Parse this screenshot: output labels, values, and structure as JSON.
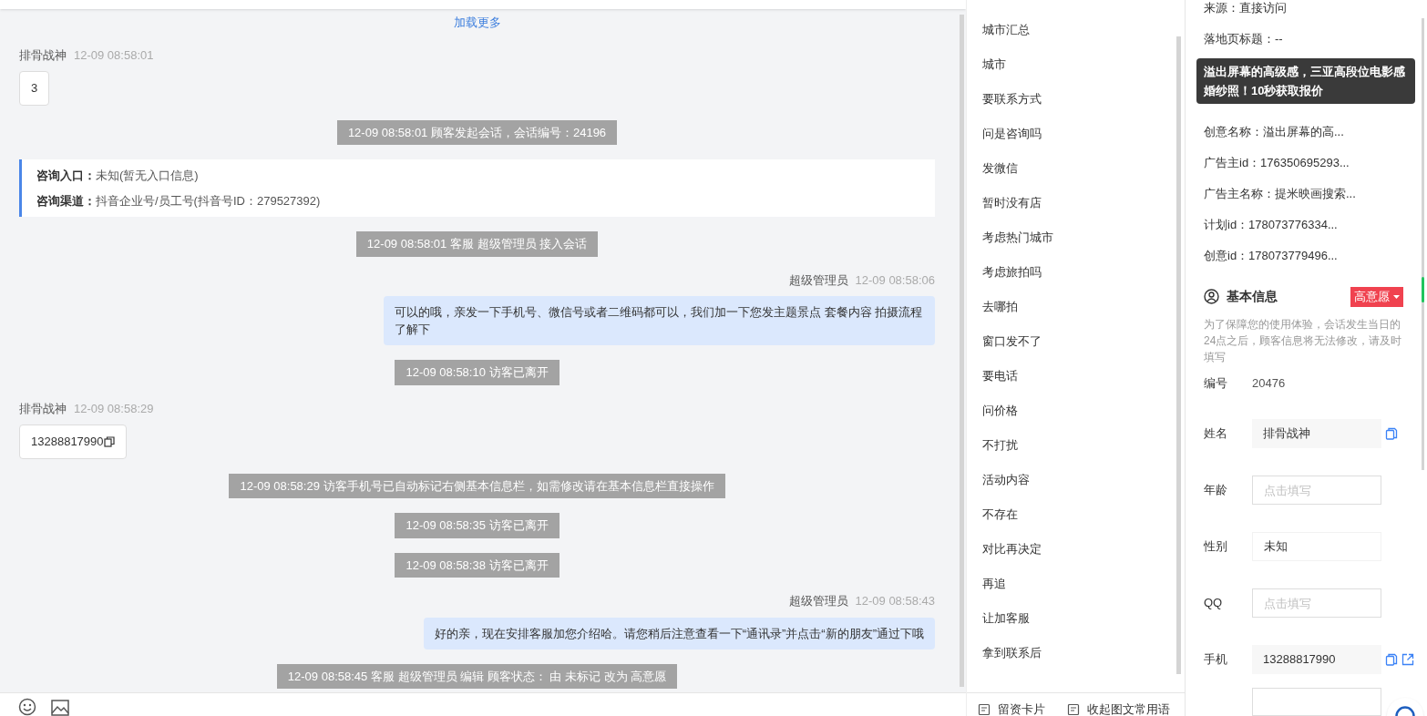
{
  "chat": {
    "load_more": "加载更多",
    "messages": [
      {
        "kind": "visitor",
        "name": "排骨战神",
        "time": "12-09 08:58:01",
        "text": "3"
      },
      {
        "kind": "system",
        "text": "12-09 08:58:01 顾客发起会话，会话编号：24196"
      },
      {
        "kind": "entry",
        "lines": [
          {
            "label": "咨询入口：",
            "value": "未知(暂无入口信息)"
          },
          {
            "label": "咨询渠道：",
            "value": "抖音企业号/员工号(抖音号ID：279527392)"
          }
        ]
      },
      {
        "kind": "system",
        "text": "12-09 08:58:01 客服 超级管理员 接入会话"
      },
      {
        "kind": "agent",
        "name": "超级管理员",
        "time": "12-09 08:58:06",
        "text": "可以的哦，亲发一下手机号、微信号或者二维码都可以，我们加一下您发主题景点 套餐内容 拍摄流程了解下"
      },
      {
        "kind": "system",
        "text": "12-09 08:58:10 访客已离开"
      },
      {
        "kind": "visitor",
        "name": "排骨战神",
        "time": "12-09 08:58:29",
        "text": "13288817990",
        "copyable": true
      },
      {
        "kind": "system",
        "text": "12-09 08:58:29 访客手机号已自动标记右侧基本信息栏，如需修改请在基本信息栏直接操作"
      },
      {
        "kind": "system",
        "text": "12-09 08:58:35 访客已离开"
      },
      {
        "kind": "system",
        "text": "12-09 08:58:38 访客已离开"
      },
      {
        "kind": "agent",
        "name": "超级管理员",
        "time": "12-09 08:58:43",
        "text": "好的亲，现在安排客服加您介绍哈。请您稍后注意查看一下“通讯录”并点击“新的朋友”通过下哦"
      },
      {
        "kind": "system",
        "text": "12-09 08:58:45 客服 超级管理员 编辑 顾客状态： 由 未标记 改为 高意愿"
      }
    ]
  },
  "phrases": {
    "items": [
      "城市汇总",
      "城市",
      "要联系方式",
      "问是咨询吗",
      "发微信",
      "暂时没有店",
      "考虑热门城市",
      "考虑旅拍吗",
      "去哪拍",
      "窗口发不了",
      "要电话",
      "问价格",
      "不打扰",
      "活动内容",
      "不存在",
      "对比再决定",
      "再追",
      "让加客服",
      "拿到联系后"
    ],
    "footer": [
      "留资卡片",
      "收起图文常用语"
    ]
  },
  "info": {
    "top_rows": [
      "来源：直接访问",
      "落地页标题：--"
    ],
    "tooltip": "溢出屏幕的高级感，三亚高段位电影感婚纱照！10秒获取报价",
    "rows": [
      "创意名称：溢出屏幕的高...",
      "广告主id：176350695293...",
      "广告主名称：提米映画搜索...",
      "计划id：178073776334...",
      "创意id：178073779496..."
    ],
    "basic": {
      "title": "基本信息",
      "tag": "高意愿",
      "note": "为了保障您的使用体验，会话发生当日的24点之后，顾客信息将无法修改，请及时填写",
      "fields": [
        {
          "kind": "plain",
          "label": "编号",
          "value": "20476"
        },
        {
          "kind": "readonly",
          "label": "姓名",
          "value": "排骨战神",
          "copy": true,
          "open": false
        },
        {
          "kind": "input",
          "label": "年龄",
          "placeholder": "点击填写"
        },
        {
          "kind": "select",
          "label": "性别",
          "value": "未知"
        },
        {
          "kind": "input",
          "label": "QQ",
          "placeholder": "点击填写"
        },
        {
          "kind": "readonly",
          "label": "手机",
          "value": "13288817990",
          "copy": true,
          "open": true
        }
      ]
    }
  }
}
